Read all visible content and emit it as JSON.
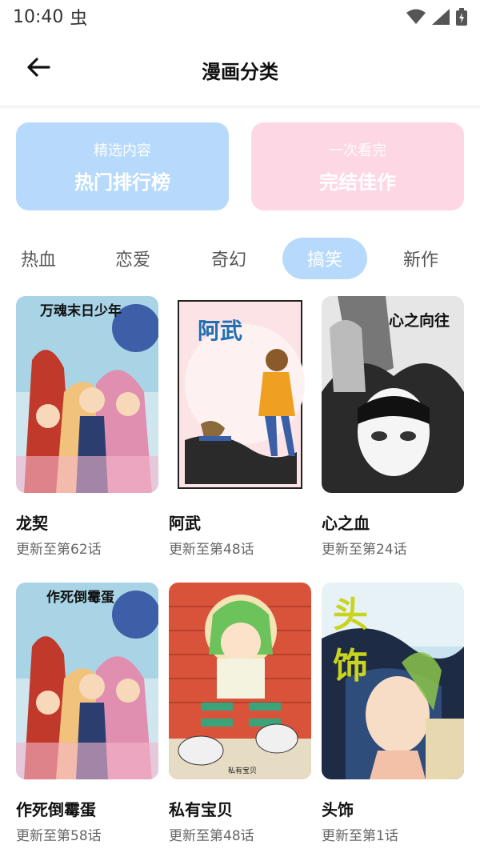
{
  "status": {
    "time": "10:40",
    "bug_glyph": "虫"
  },
  "header": {
    "title": "漫画分类"
  },
  "promos": [
    {
      "sub": "精选内容",
      "main": "热门排行榜"
    },
    {
      "sub": "一次看完",
      "main": "完结佳作"
    }
  ],
  "tabs": [
    {
      "label": "热血",
      "active": false
    },
    {
      "label": "恋爱",
      "active": false
    },
    {
      "label": "奇幻",
      "active": false
    },
    {
      "label": "搞笑",
      "active": true
    },
    {
      "label": "新作",
      "active": false
    }
  ],
  "comics": [
    {
      "title": "龙契",
      "update": "更新至第62话",
      "cover_text": "万魂末日少年"
    },
    {
      "title": "阿武",
      "update": "更新至第48话",
      "cover_text": "阿武"
    },
    {
      "title": "心之血",
      "update": "更新至第24话",
      "cover_text": "心之向往"
    },
    {
      "title": "作死倒霉蛋",
      "update": "更新至第58话",
      "cover_text": "作死倒霉蛋"
    },
    {
      "title": "私有宝贝",
      "update": "更新至第48话",
      "cover_text": "私有宝贝"
    },
    {
      "title": "头饰",
      "update": "更新至第1话",
      "cover_text": "头饰"
    }
  ],
  "colors": {
    "accent_blue": "#b7dafc",
    "accent_pink": "#fdd7e3"
  }
}
